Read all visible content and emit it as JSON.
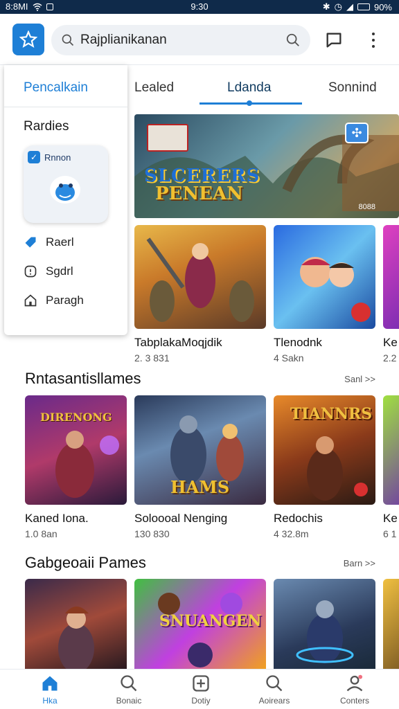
{
  "status": {
    "left": "8:8MI",
    "time": "9:30",
    "battery": "90%"
  },
  "search": {
    "value": "Rajplianikanan"
  },
  "sidebar": {
    "title": "Pencalkain",
    "section": "Rardies",
    "card_label": "Rnnon",
    "items": [
      {
        "label": "Raerl",
        "icon": "tag-icon"
      },
      {
        "label": "Sgdrl",
        "icon": "info-icon"
      },
      {
        "label": "Paragh",
        "icon": "home-icon"
      }
    ]
  },
  "tabs": [
    "Lealed",
    "Ldanda",
    "Sonnind"
  ],
  "hero": {
    "title1": "SLCERERS",
    "title2": "PENEAN",
    "count": "8088"
  },
  "row1": [
    {
      "name": "TabplakaMoqjdik",
      "meta": "2. 3 831"
    },
    {
      "name": "Tlenodnk",
      "meta": "4 Sakn"
    },
    {
      "name": "Ke",
      "meta": "2.2"
    }
  ],
  "section1": {
    "title": "Rntasantisllames",
    "see_all": "Sanl >>"
  },
  "row2": [
    {
      "name": "Kaned Iona.",
      "meta": "1.0 8an",
      "art_text": "DIRENONG"
    },
    {
      "name": "Soloooal Nenging",
      "meta": "130 830",
      "art_text": "HAMS"
    },
    {
      "name": "Redochis",
      "meta": "4 32.8m",
      "art_text": "TIANNRS"
    },
    {
      "name": "Ke",
      "meta": "6 1"
    }
  ],
  "section2": {
    "title": "Gabgeoaii Pames",
    "see_all": "Barn >>"
  },
  "row3_art": "SNUANGEN",
  "nav": [
    {
      "label": "Hka",
      "icon": "home-icon",
      "active": true
    },
    {
      "label": "Bonaic",
      "icon": "search-icon"
    },
    {
      "label": "Dotiy",
      "icon": "plus-box-icon"
    },
    {
      "label": "Aoirears",
      "icon": "search-icon"
    },
    {
      "label": "Conters",
      "icon": "profile-icon"
    }
  ],
  "colors": {
    "accent": "#1e7fd6",
    "status_bar": "#0f2a4a"
  }
}
